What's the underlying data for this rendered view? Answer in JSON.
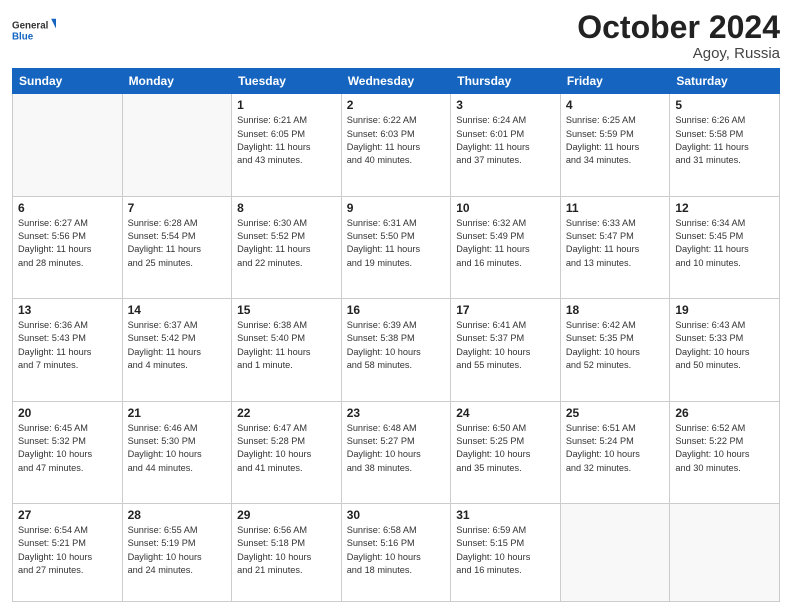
{
  "header": {
    "logo_general": "General",
    "logo_blue": "Blue",
    "month": "October 2024",
    "location": "Agoy, Russia"
  },
  "days_of_week": [
    "Sunday",
    "Monday",
    "Tuesday",
    "Wednesday",
    "Thursday",
    "Friday",
    "Saturday"
  ],
  "weeks": [
    [
      {
        "day": "",
        "info": ""
      },
      {
        "day": "",
        "info": ""
      },
      {
        "day": "1",
        "info": "Sunrise: 6:21 AM\nSunset: 6:05 PM\nDaylight: 11 hours\nand 43 minutes."
      },
      {
        "day": "2",
        "info": "Sunrise: 6:22 AM\nSunset: 6:03 PM\nDaylight: 11 hours\nand 40 minutes."
      },
      {
        "day": "3",
        "info": "Sunrise: 6:24 AM\nSunset: 6:01 PM\nDaylight: 11 hours\nand 37 minutes."
      },
      {
        "day": "4",
        "info": "Sunrise: 6:25 AM\nSunset: 5:59 PM\nDaylight: 11 hours\nand 34 minutes."
      },
      {
        "day": "5",
        "info": "Sunrise: 6:26 AM\nSunset: 5:58 PM\nDaylight: 11 hours\nand 31 minutes."
      }
    ],
    [
      {
        "day": "6",
        "info": "Sunrise: 6:27 AM\nSunset: 5:56 PM\nDaylight: 11 hours\nand 28 minutes."
      },
      {
        "day": "7",
        "info": "Sunrise: 6:28 AM\nSunset: 5:54 PM\nDaylight: 11 hours\nand 25 minutes."
      },
      {
        "day": "8",
        "info": "Sunrise: 6:30 AM\nSunset: 5:52 PM\nDaylight: 11 hours\nand 22 minutes."
      },
      {
        "day": "9",
        "info": "Sunrise: 6:31 AM\nSunset: 5:50 PM\nDaylight: 11 hours\nand 19 minutes."
      },
      {
        "day": "10",
        "info": "Sunrise: 6:32 AM\nSunset: 5:49 PM\nDaylight: 11 hours\nand 16 minutes."
      },
      {
        "day": "11",
        "info": "Sunrise: 6:33 AM\nSunset: 5:47 PM\nDaylight: 11 hours\nand 13 minutes."
      },
      {
        "day": "12",
        "info": "Sunrise: 6:34 AM\nSunset: 5:45 PM\nDaylight: 11 hours\nand 10 minutes."
      }
    ],
    [
      {
        "day": "13",
        "info": "Sunrise: 6:36 AM\nSunset: 5:43 PM\nDaylight: 11 hours\nand 7 minutes."
      },
      {
        "day": "14",
        "info": "Sunrise: 6:37 AM\nSunset: 5:42 PM\nDaylight: 11 hours\nand 4 minutes."
      },
      {
        "day": "15",
        "info": "Sunrise: 6:38 AM\nSunset: 5:40 PM\nDaylight: 11 hours\nand 1 minute."
      },
      {
        "day": "16",
        "info": "Sunrise: 6:39 AM\nSunset: 5:38 PM\nDaylight: 10 hours\nand 58 minutes."
      },
      {
        "day": "17",
        "info": "Sunrise: 6:41 AM\nSunset: 5:37 PM\nDaylight: 10 hours\nand 55 minutes."
      },
      {
        "day": "18",
        "info": "Sunrise: 6:42 AM\nSunset: 5:35 PM\nDaylight: 10 hours\nand 52 minutes."
      },
      {
        "day": "19",
        "info": "Sunrise: 6:43 AM\nSunset: 5:33 PM\nDaylight: 10 hours\nand 50 minutes."
      }
    ],
    [
      {
        "day": "20",
        "info": "Sunrise: 6:45 AM\nSunset: 5:32 PM\nDaylight: 10 hours\nand 47 minutes."
      },
      {
        "day": "21",
        "info": "Sunrise: 6:46 AM\nSunset: 5:30 PM\nDaylight: 10 hours\nand 44 minutes."
      },
      {
        "day": "22",
        "info": "Sunrise: 6:47 AM\nSunset: 5:28 PM\nDaylight: 10 hours\nand 41 minutes."
      },
      {
        "day": "23",
        "info": "Sunrise: 6:48 AM\nSunset: 5:27 PM\nDaylight: 10 hours\nand 38 minutes."
      },
      {
        "day": "24",
        "info": "Sunrise: 6:50 AM\nSunset: 5:25 PM\nDaylight: 10 hours\nand 35 minutes."
      },
      {
        "day": "25",
        "info": "Sunrise: 6:51 AM\nSunset: 5:24 PM\nDaylight: 10 hours\nand 32 minutes."
      },
      {
        "day": "26",
        "info": "Sunrise: 6:52 AM\nSunset: 5:22 PM\nDaylight: 10 hours\nand 30 minutes."
      }
    ],
    [
      {
        "day": "27",
        "info": "Sunrise: 6:54 AM\nSunset: 5:21 PM\nDaylight: 10 hours\nand 27 minutes."
      },
      {
        "day": "28",
        "info": "Sunrise: 6:55 AM\nSunset: 5:19 PM\nDaylight: 10 hours\nand 24 minutes."
      },
      {
        "day": "29",
        "info": "Sunrise: 6:56 AM\nSunset: 5:18 PM\nDaylight: 10 hours\nand 21 minutes."
      },
      {
        "day": "30",
        "info": "Sunrise: 6:58 AM\nSunset: 5:16 PM\nDaylight: 10 hours\nand 18 minutes."
      },
      {
        "day": "31",
        "info": "Sunrise: 6:59 AM\nSunset: 5:15 PM\nDaylight: 10 hours\nand 16 minutes."
      },
      {
        "day": "",
        "info": ""
      },
      {
        "day": "",
        "info": ""
      }
    ]
  ]
}
